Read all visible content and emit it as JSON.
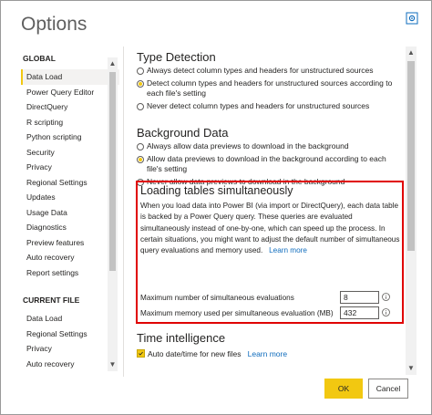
{
  "window": {
    "title": "Options"
  },
  "nav": {
    "global_header": "GLOBAL",
    "global_items": [
      "Data Load",
      "Power Query Editor",
      "DirectQuery",
      "R scripting",
      "Python scripting",
      "Security",
      "Privacy",
      "Regional Settings",
      "Updates",
      "Usage Data",
      "Diagnostics",
      "Preview features",
      "Auto recovery",
      "Report settings"
    ],
    "active_item": "Data Load",
    "current_header": "CURRENT FILE",
    "current_items": [
      "Data Load",
      "Regional Settings",
      "Privacy",
      "Auto recovery"
    ]
  },
  "type_detection": {
    "title": "Type Detection",
    "options": [
      "Always detect column types and headers for unstructured sources",
      "Detect column types and headers for unstructured sources according to each file's setting",
      "Never detect column types and headers for unstructured sources"
    ],
    "selected_index": 1
  },
  "background_data": {
    "title": "Background Data",
    "options": [
      "Always allow data previews to download in the background",
      "Allow data previews to download in the background according to each file's setting",
      "Never allow data previews to download in the background"
    ],
    "selected_index": 1
  },
  "loading_tables": {
    "title": "Loading tables simultaneously",
    "description": "When you load data into Power BI (via import or DirectQuery), each data table is backed by a Power Query query. These queries are evaluated simultaneously instead of one-by-one, which can speed up the process. In certain situations, you might want to adjust the default number of simultaneous query evaluations and memory used.",
    "learn_more": "Learn more",
    "max_evaluations_label": "Maximum number of simultaneous evaluations",
    "max_evaluations_value": "8",
    "max_memory_label": "Maximum memory used per simultaneous evaluation (MB)",
    "max_memory_value": "432"
  },
  "time_intelligence": {
    "title": "Time intelligence",
    "auto_date_label": "Auto date/time for new files",
    "auto_date_checked": true,
    "learn_more": "Learn more"
  },
  "footer": {
    "ok_label": "OK",
    "cancel_label": "Cancel"
  },
  "colors": {
    "accent": "#f2c811",
    "highlight_border": "#e00000",
    "link": "#0f6cbd"
  },
  "icons": {
    "settings": "gear-icon",
    "info": "info-icon",
    "scroll_up": "chevron-up-icon",
    "scroll_down": "chevron-down-icon"
  }
}
